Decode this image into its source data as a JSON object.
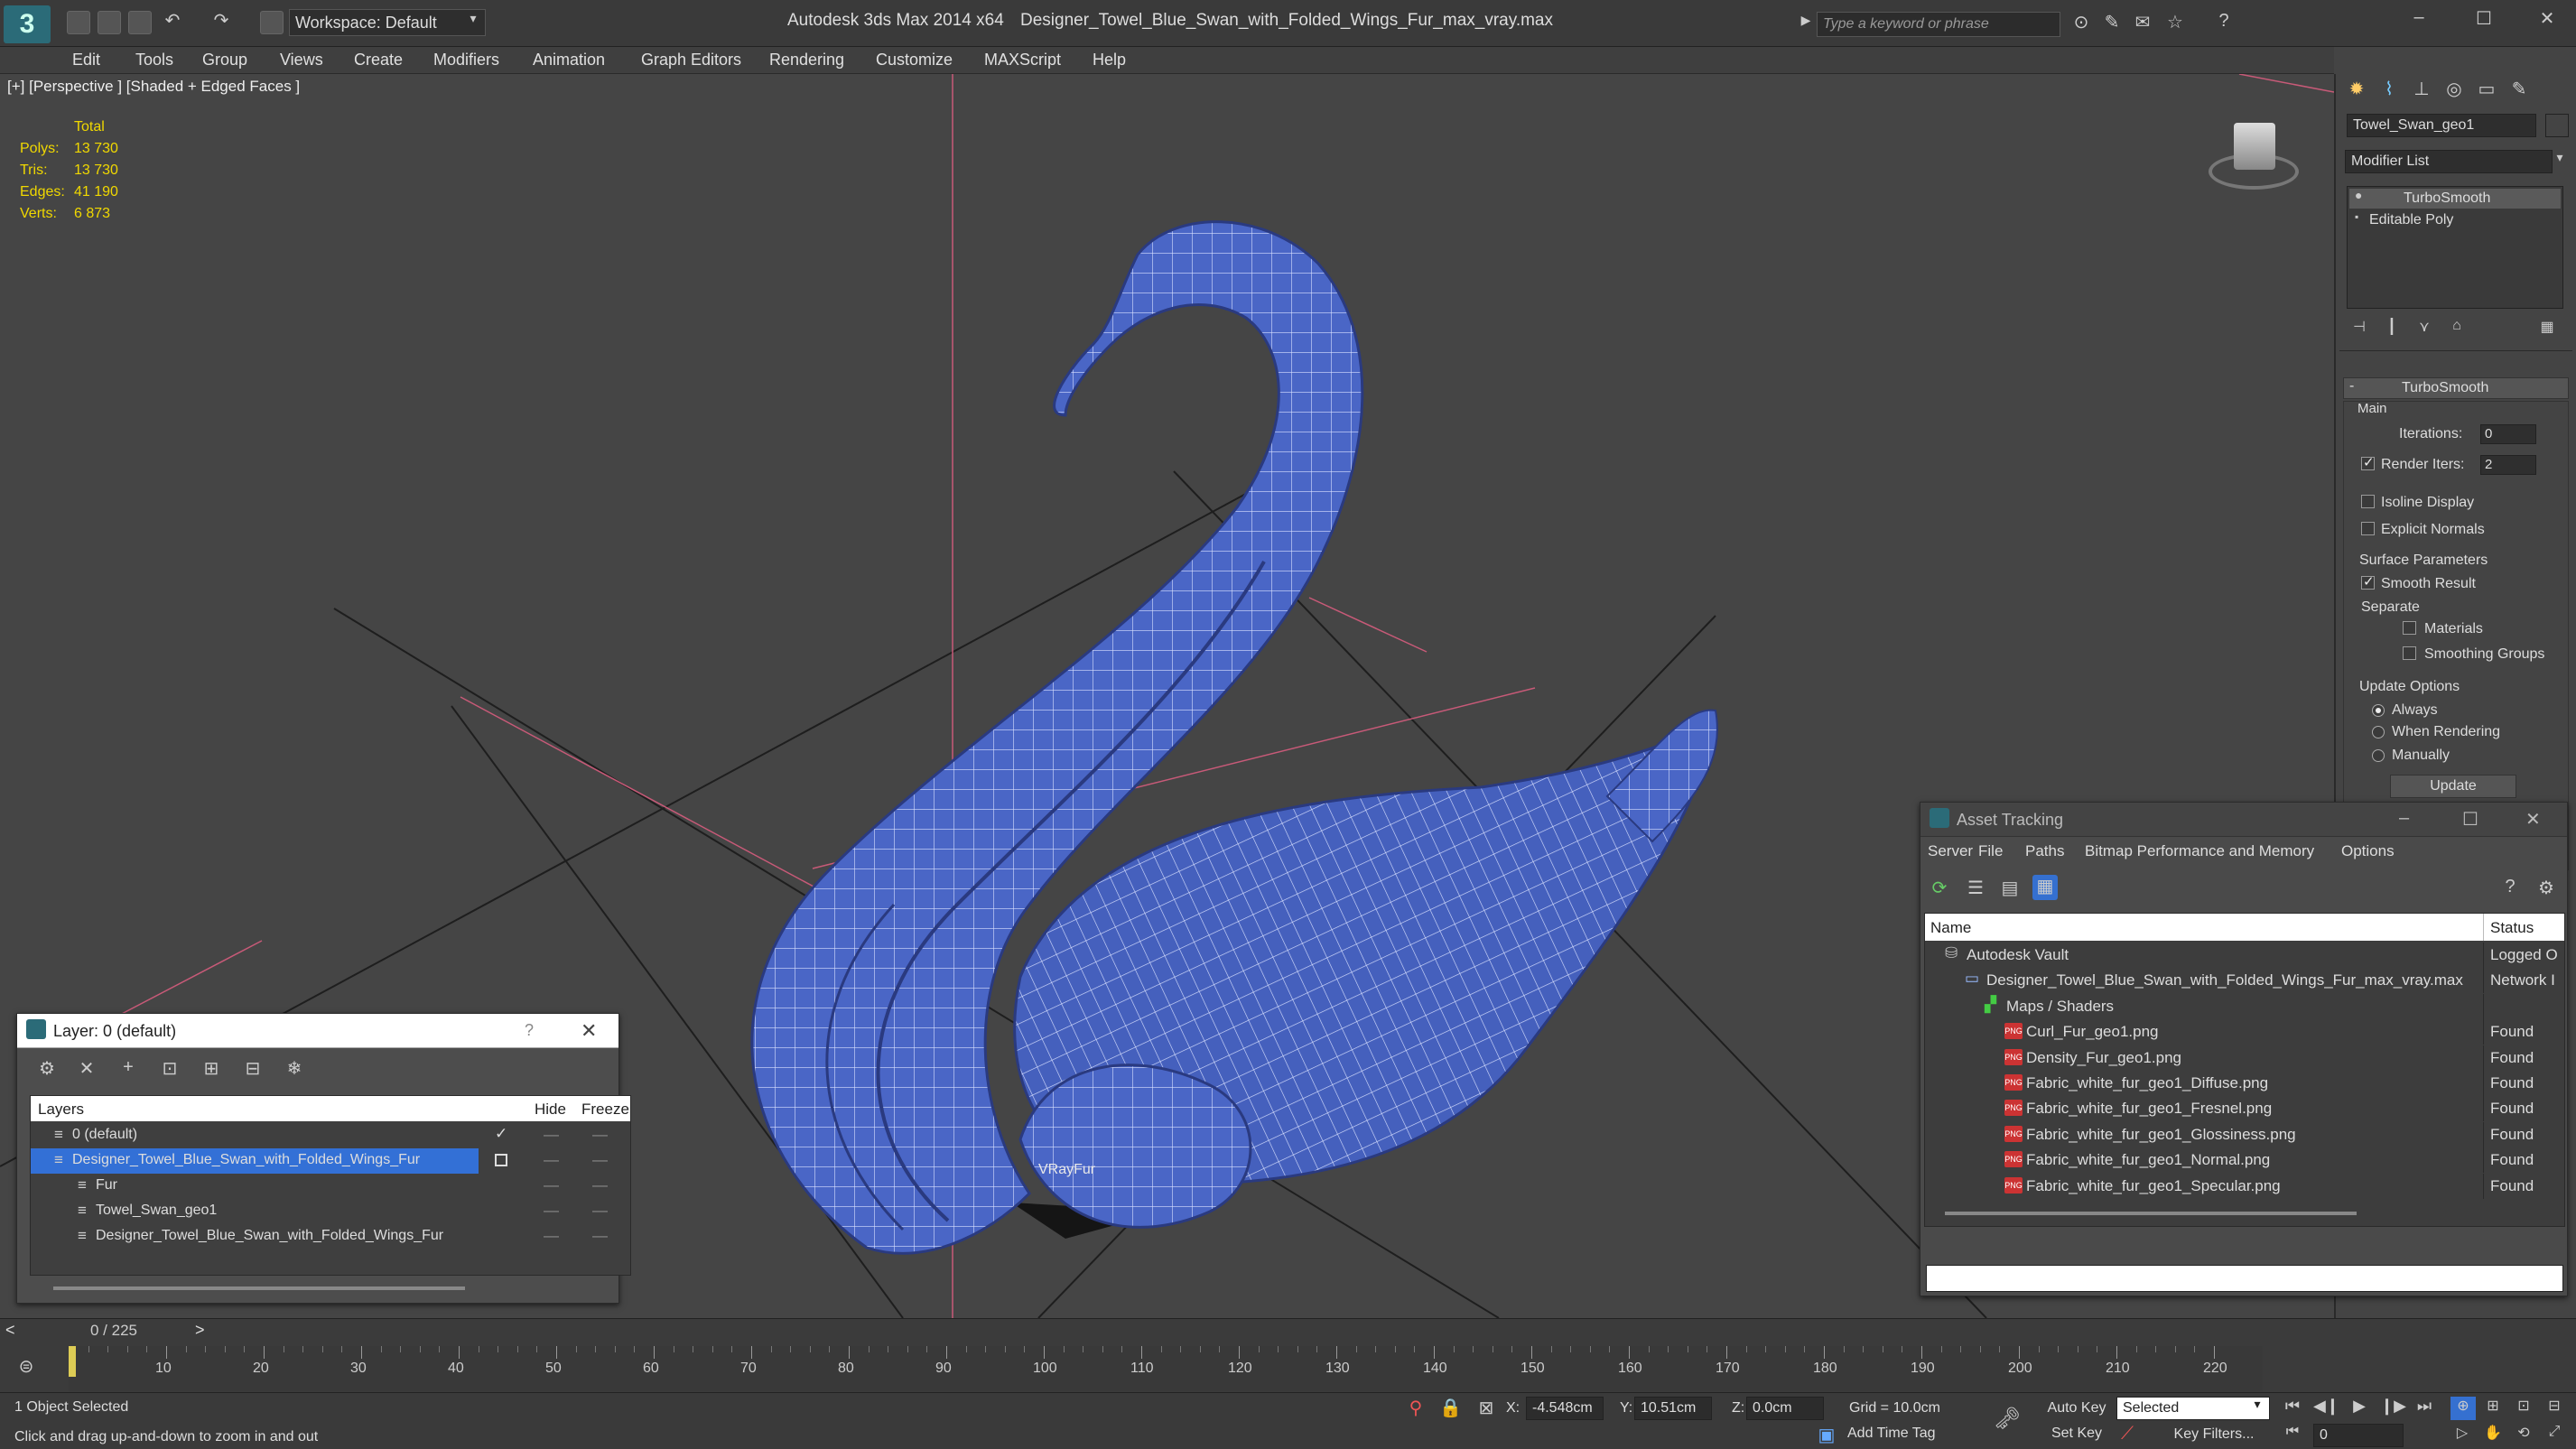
{
  "titlebar": {
    "app_title": "Autodesk 3ds Max  2014 x64",
    "file_title": "Designer_Towel_Blue_Swan_with_Folded_Wings_Fur_max_vray.max",
    "workspace": "Workspace: Default",
    "search_placeholder": "Type a keyword or phrase"
  },
  "menu": [
    "Edit",
    "Tools",
    "Group",
    "Views",
    "Create",
    "Modifiers",
    "Animation",
    "Graph Editors",
    "Rendering",
    "Customize",
    "MAXScript",
    "Help"
  ],
  "viewport": {
    "label": "[+] [Perspective ] [Shaded + Edged Faces ]",
    "stats_header": "Total",
    "stats": [
      {
        "label": "Polys:",
        "value": "13 730"
      },
      {
        "label": "Tris:",
        "value": "13 730"
      },
      {
        "label": "Edges:",
        "value": "41 190"
      },
      {
        "label": "Verts:",
        "value": "6 873"
      }
    ],
    "object_label": "VRayFur"
  },
  "command_panel": {
    "object_name": "Towel_Swan_geo1",
    "modifier_list": "Modifier List",
    "stack": [
      "TurboSmooth",
      "Editable Poly"
    ],
    "rollout_title": "TurboSmooth",
    "main_label": "Main",
    "iterations_label": "Iterations:",
    "iterations_value": "0",
    "render_iters_label": "Render Iters:",
    "render_iters_value": "2",
    "isoline_label": "Isoline Display",
    "explicit_normals_label": "Explicit Normals",
    "surface_params_label": "Surface Parameters",
    "smooth_result_label": "Smooth Result",
    "separate_label": "Separate",
    "materials_label": "Materials",
    "smoothing_groups_label": "Smoothing Groups",
    "update_options_label": "Update Options",
    "always_label": "Always",
    "when_rendering_label": "When Rendering",
    "manually_label": "Manually",
    "update_button": "Update"
  },
  "layer_window": {
    "title": "Layer: 0 (default)",
    "help": "?",
    "col_layers": "Layers",
    "col_hide": "Hide",
    "col_freeze": "Freeze",
    "rows": [
      {
        "name": "0 (default)",
        "indent": 0
      },
      {
        "name": "Designer_Towel_Blue_Swan_with_Folded_Wings_Fur",
        "indent": 0
      },
      {
        "name": "Fur",
        "indent": 1
      },
      {
        "name": "Towel_Swan_geo1",
        "indent": 1
      },
      {
        "name": "Designer_Towel_Blue_Swan_with_Folded_Wings_Fur",
        "indent": 1
      }
    ]
  },
  "asset_window": {
    "title": "Asset Tracking",
    "menu": [
      "Server",
      "File",
      "Paths",
      "Bitmap Performance and Memory",
      "Options"
    ],
    "col_name": "Name",
    "col_status": "Status",
    "rows": [
      {
        "name": "Autodesk Vault",
        "status": "Logged O",
        "indent": 1,
        "icon": "vault"
      },
      {
        "name": "Designer_Towel_Blue_Swan_with_Folded_Wings_Fur_max_vray.max",
        "status": "Network I",
        "indent": 2,
        "icon": "max"
      },
      {
        "name": "Maps / Shaders",
        "status": "",
        "indent": 3,
        "icon": "maps"
      },
      {
        "name": "Curl_Fur_geo1.png",
        "status": "Found",
        "indent": 4,
        "icon": "png"
      },
      {
        "name": "Density_Fur_geo1.png",
        "status": "Found",
        "indent": 4,
        "icon": "png"
      },
      {
        "name": "Fabric_white_fur_geo1_Diffuse.png",
        "status": "Found",
        "indent": 4,
        "icon": "png"
      },
      {
        "name": "Fabric_white_fur_geo1_Fresnel.png",
        "status": "Found",
        "indent": 4,
        "icon": "png"
      },
      {
        "name": "Fabric_white_fur_geo1_Glossiness.png",
        "status": "Found",
        "indent": 4,
        "icon": "png"
      },
      {
        "name": "Fabric_white_fur_geo1_Normal.png",
        "status": "Found",
        "indent": 4,
        "icon": "png"
      },
      {
        "name": "Fabric_white_fur_geo1_Specular.png",
        "status": "Found",
        "indent": 4,
        "icon": "png"
      }
    ]
  },
  "timeline": {
    "frame_display": "0 / 225",
    "ticks": [
      "10",
      "20",
      "30",
      "40",
      "50",
      "60",
      "70",
      "80",
      "90",
      "100",
      "110",
      "120",
      "130",
      "140",
      "150",
      "160",
      "170",
      "180",
      "190",
      "200",
      "210",
      "220"
    ]
  },
  "status": {
    "selection": "1 Object Selected",
    "hint": "Click and drag up-and-down to zoom in and out",
    "x_label": "X:",
    "x_value": "-4.548cm",
    "y_label": "Y:",
    "y_value": "10.51cm",
    "z_label": "Z:",
    "z_value": "0.0cm",
    "grid": "Grid = 10.0cm",
    "auto_key": "Auto Key",
    "set_key": "Set Key",
    "selected_dropdown": "Selected",
    "key_filters": "Key Filters...",
    "add_time_tag": "Add Time Tag",
    "frame_field": "0"
  },
  "colors": {
    "swan": "#4a66c6",
    "selection": "#3370d6",
    "viewport_bg": "#454545"
  }
}
